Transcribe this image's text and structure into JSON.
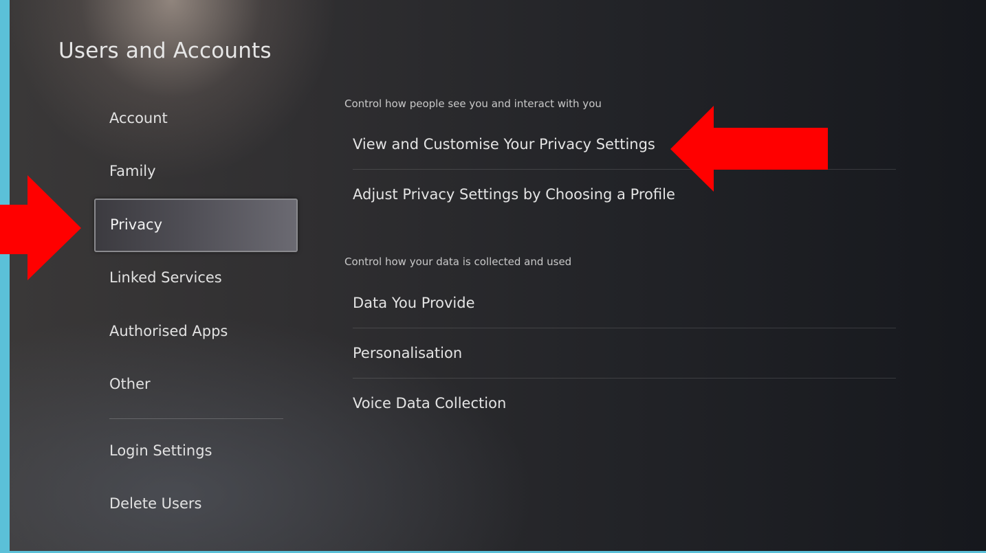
{
  "page": {
    "title": "Users and Accounts"
  },
  "sidebar": {
    "items": [
      {
        "label": "Account"
      },
      {
        "label": "Family"
      },
      {
        "label": "Privacy",
        "selected": true
      },
      {
        "label": "Linked Services"
      },
      {
        "label": "Authorised Apps"
      },
      {
        "label": "Other"
      },
      {
        "label": "Login Settings"
      },
      {
        "label": "Delete Users"
      }
    ]
  },
  "main": {
    "sections": [
      {
        "caption": "Control how people see you and interact with you",
        "options": [
          {
            "label": "View and Customise Your Privacy Settings"
          },
          {
            "label": "Adjust Privacy Settings by Choosing a Profile"
          }
        ]
      },
      {
        "caption": "Control how your data is collected and used",
        "options": [
          {
            "label": "Data You Provide"
          },
          {
            "label": "Personalisation"
          },
          {
            "label": "Voice Data Collection"
          }
        ]
      }
    ]
  },
  "annotations": {
    "arrow_color": "#ff0000",
    "frame_color": "#5bc0d8",
    "arrows": [
      {
        "points_to": "sidebar-item-privacy",
        "direction": "right"
      },
      {
        "points_to": "option-view-customise-privacy-settings",
        "direction": "left"
      }
    ]
  }
}
